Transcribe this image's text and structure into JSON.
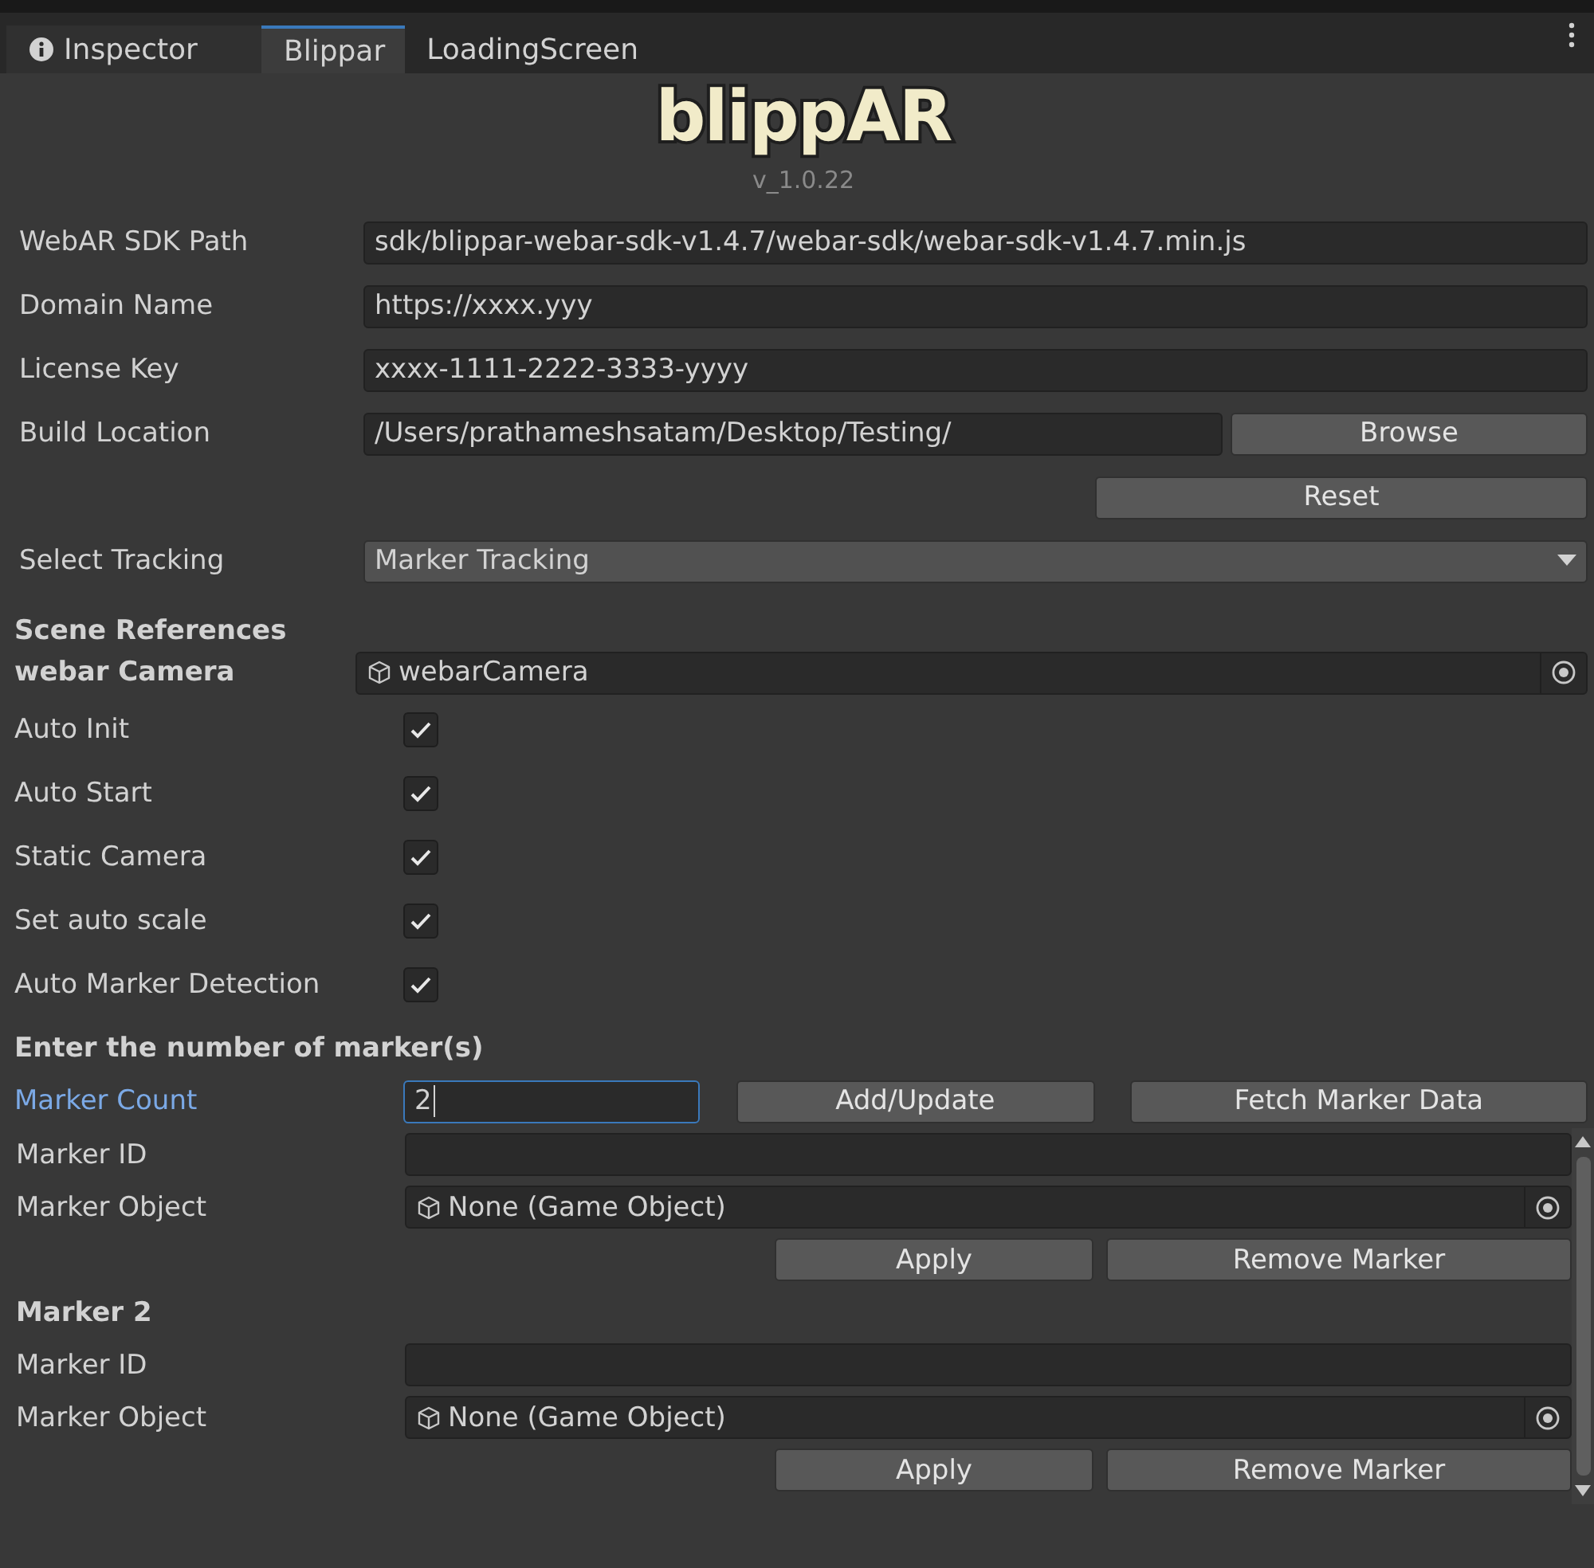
{
  "tabs": [
    {
      "label": "Inspector",
      "kind": "icon",
      "selected": false
    },
    {
      "label": "Blippar",
      "kind": "text",
      "selected": true
    },
    {
      "label": "LoadingScreen",
      "kind": "text",
      "selected": false
    }
  ],
  "logo": "blippAR",
  "version": "v_1.0.22",
  "fields": [
    {
      "label": "WebAR SDK Path",
      "value": "sdk/blippar-webar-sdk-v1.4.7/webar-sdk/webar-sdk-v1.4.7.min.js"
    },
    {
      "label": "Domain Name",
      "value": "https://xxxx.yyy"
    },
    {
      "label": "License Key",
      "value": "xxxx-1111-2222-3333-yyyy"
    }
  ],
  "build_location": {
    "label": "Build Location",
    "value": "/Users/prathameshsatam/Desktop/Testing/",
    "button": "Browse"
  },
  "reset_button": "Reset",
  "select_tracking": {
    "label": "Select Tracking",
    "value": "Marker Tracking"
  },
  "scene_references": "Scene References",
  "webar_camera": {
    "label": "webar Camera",
    "value": "webarCamera"
  },
  "checkboxes": [
    {
      "label": "Auto Init",
      "checked": true
    },
    {
      "label": "Auto Start",
      "checked": true
    },
    {
      "label": "Static Camera",
      "checked": true
    },
    {
      "label": "Set auto scale",
      "checked": true
    },
    {
      "label": "Auto Marker Detection",
      "checked": true
    }
  ],
  "marker_heading": "Enter the number of marker(s)",
  "marker_count": {
    "label": "Marker Count",
    "value": "2",
    "focused": true
  },
  "marker_buttons": [
    "Add/Update",
    "Fetch Marker Data"
  ],
  "markers": [
    {
      "id_label": "Marker ID",
      "object_label": "Marker Object",
      "object_value": "None (Game Object)",
      "buttons": [
        "Apply",
        "Remove Marker"
      ]
    },
    {
      "title": "Marker 2",
      "id_label": "Marker ID",
      "object_label": "Marker Object",
      "object_value": "None (Game Object)",
      "buttons": [
        "Apply",
        "Remove Marker"
      ]
    }
  ]
}
